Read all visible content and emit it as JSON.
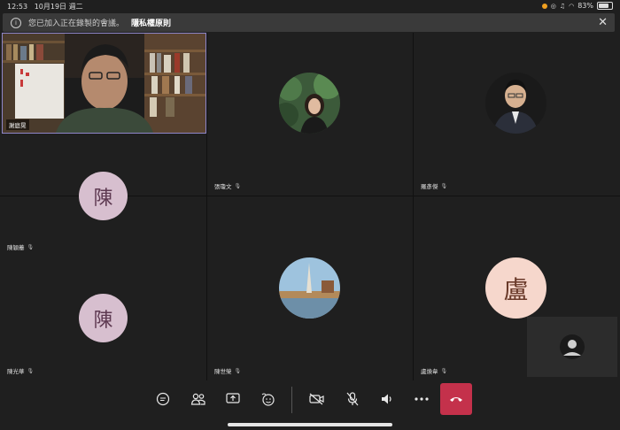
{
  "status_bar": {
    "time": "12:53",
    "date": "10月19日 週二",
    "battery": "83%"
  },
  "banner": {
    "message": "您已加入正在錄製的會議。",
    "link": "隱私權原則"
  },
  "participants": [
    {
      "name": "謝庭晃",
      "type": "video"
    },
    {
      "name": "張瓊文",
      "type": "photo"
    },
    {
      "name": "羅彥傑",
      "type": "photo"
    },
    {
      "name": "陳穎蓁",
      "type": "letter",
      "letter": "陳",
      "color": "#d7bfcf"
    },
    {
      "name": "陳光華",
      "type": "letter",
      "letter": "陳",
      "color": "#d7bfcf"
    },
    {
      "name": "陳世榮",
      "type": "photo"
    },
    {
      "name": "盧煥韋",
      "type": "letter",
      "letter": "盧",
      "color": "#f6d7cc"
    }
  ],
  "toolbar": {
    "icons": [
      "chat-icon",
      "participants-icon",
      "share-icon",
      "reactions-icon",
      "camera-off-icon",
      "mic-off-icon",
      "speaker-icon",
      "more-icon",
      "hangup-icon"
    ],
    "accent": "#c4314b"
  }
}
